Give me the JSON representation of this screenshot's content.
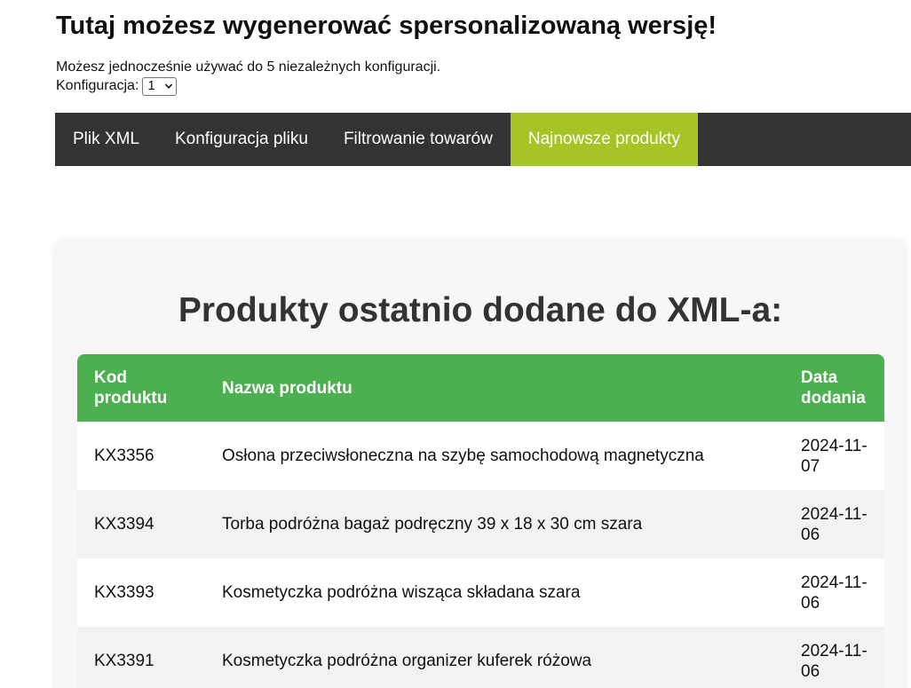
{
  "header": {
    "title": "Tutaj możesz wygenerować spersonalizowaną wersję!",
    "info_text": "Możesz jednocześnie używać do 5 niezależnych konfiguracji.",
    "config_label": "Konfiguracja:",
    "config_value": "1"
  },
  "nav": {
    "tabs": [
      {
        "label": "Plik XML",
        "active": false
      },
      {
        "label": "Konfiguracja pliku",
        "active": false
      },
      {
        "label": "Filtrowanie towarów",
        "active": false
      },
      {
        "label": "Najnowsze produkty",
        "active": true
      }
    ]
  },
  "content": {
    "title": "Produkty ostatnio dodane do XML-a:",
    "table": {
      "headers": {
        "code_line1": "Kod",
        "code_line2": "produktu",
        "name": "Nazwa produktu",
        "date_line1": "Data",
        "date_line2": "dodania"
      },
      "rows": [
        {
          "code": "KX3356",
          "name": "Osłona przeciwsłoneczna na szybę samochodową magnetyczna",
          "date_line1": "2024-11-",
          "date_line2": "07"
        },
        {
          "code": "KX3394",
          "name": "Torba podróżna bagaż podręczny 39 x 18 x 30 cm szara",
          "date_line1": "2024-11-",
          "date_line2": "06"
        },
        {
          "code": "KX3393",
          "name": "Kosmetyczka podróżna wisząca składana szara",
          "date_line1": "2024-11-",
          "date_line2": "06"
        },
        {
          "code": "KX3391",
          "name": "Kosmetyczka podróżna organizer kuferek różowa",
          "date_line1": "2024-11-",
          "date_line2": "06"
        }
      ]
    }
  },
  "colors": {
    "nav_background": "#333333",
    "active_tab": "#a5c425",
    "table_header": "#4caf50",
    "card_background": "#f7f7f7"
  },
  "icons": {
    "select_arrow": "chevron-down-icon"
  }
}
